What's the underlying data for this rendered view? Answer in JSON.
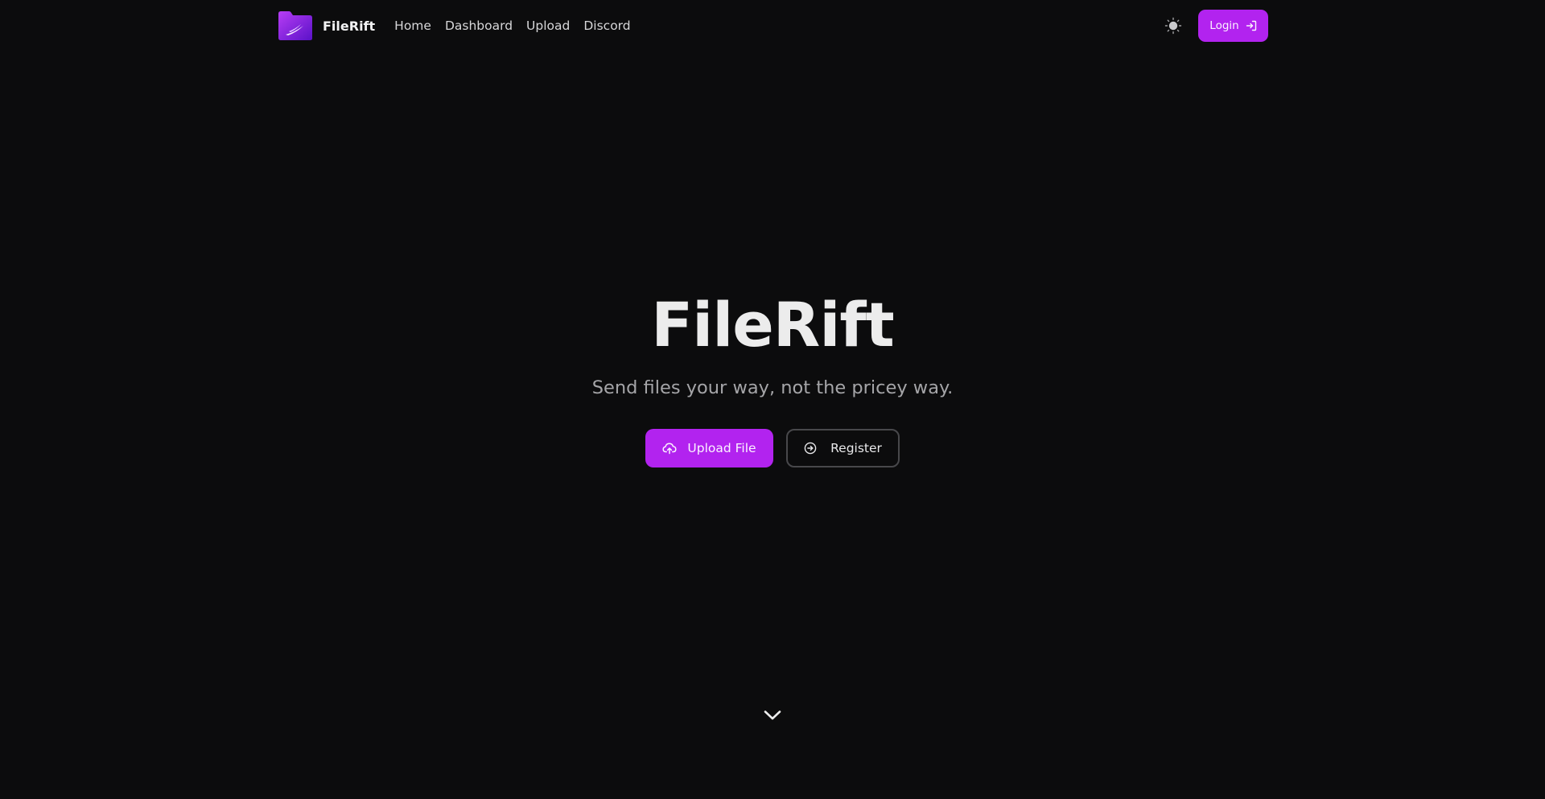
{
  "nav": {
    "brand_name": "FileRift",
    "links": [
      {
        "label": "Home"
      },
      {
        "label": "Dashboard"
      },
      {
        "label": "Upload"
      },
      {
        "label": "Discord"
      }
    ],
    "theme_toggle_icon": "sun-icon",
    "login_label": "Login",
    "login_icon": "sign-in-icon"
  },
  "hero": {
    "title": "FileRift",
    "subtitle": "Send files your way, not the pricey way.",
    "upload_label": "Upload File",
    "upload_icon": "cloud-upload-icon",
    "register_label": "Register",
    "register_icon": "circle-arrow-right-icon",
    "scroll_icon": "chevron-down-icon"
  },
  "colors": {
    "background": "#0c0c0d",
    "accent": "#b223ef",
    "text_primary": "#ececec",
    "text_muted": "#a5a5a8",
    "outline_border": "#48484b"
  }
}
